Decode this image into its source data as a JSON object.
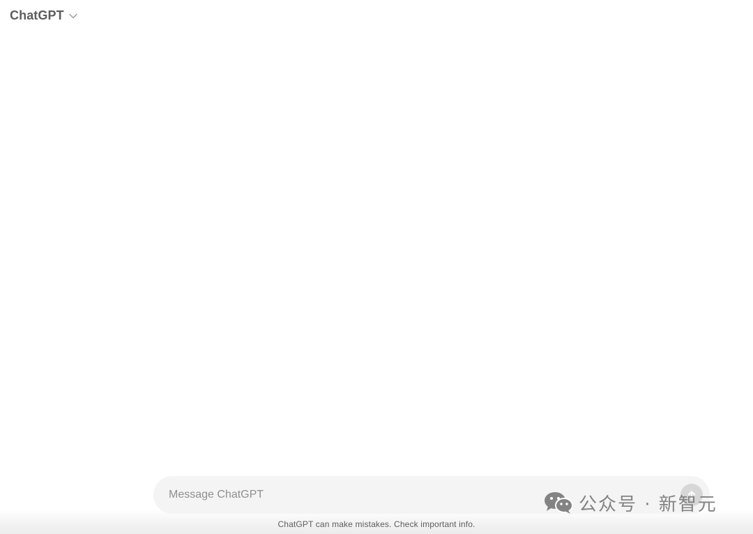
{
  "header": {
    "model_name": "ChatGPT",
    "dropdown_icon": "chevron-down-icon"
  },
  "composer": {
    "placeholder": "Message ChatGPT",
    "value": "",
    "send_icon": "arrow-up-icon"
  },
  "footer": {
    "disclaimer": "ChatGPT can make mistakes. Check important info."
  },
  "watermark": {
    "text": "公众号 · 新智元",
    "icon": "wechat-logo-icon"
  },
  "colors": {
    "background": "#ffffff",
    "composer_background": "#f4f4f4",
    "header_text": "#5d5d5d",
    "send_button_disabled": "#d7d7d7",
    "watermark": "#7a7a7a"
  }
}
